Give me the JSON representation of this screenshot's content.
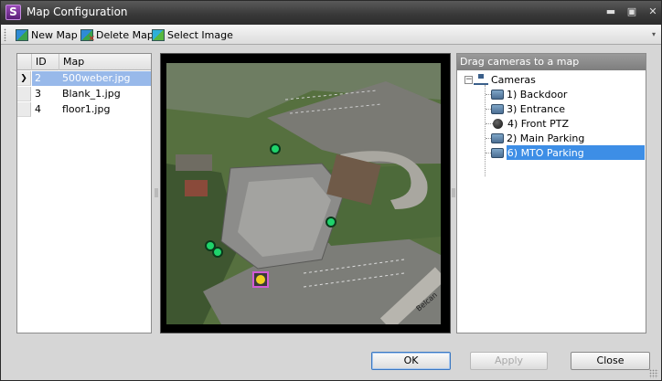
{
  "window": {
    "title": "Map Configuration",
    "app_icon_letter": "S"
  },
  "titlebar_buttons": {
    "minimize": "▬",
    "maximize": "▣",
    "close": "✕"
  },
  "toolbar": {
    "new_map": "New Map",
    "delete_map": "Delete Map",
    "select_image": "Select Image",
    "overflow": "▾"
  },
  "map_list": {
    "columns": {
      "id": "ID",
      "map": "Map"
    },
    "current_row_marker": "❯",
    "rows": [
      {
        "id": "2",
        "map": "500weber.jpg",
        "selected": true
      },
      {
        "id": "3",
        "map": "Blank_1.jpg",
        "selected": false
      },
      {
        "id": "4",
        "map": "floor1.jpg",
        "selected": false
      }
    ]
  },
  "map_view": {
    "road_label": "Belcan"
  },
  "camera_tree": {
    "header": "Drag cameras to a map",
    "root": {
      "label": "Cameras",
      "expander": "−"
    },
    "items": [
      {
        "label": "1) Backdoor",
        "icon": "camera-icon",
        "selected": false
      },
      {
        "label": "3) Entrance",
        "icon": "camera-icon",
        "selected": false
      },
      {
        "label": "4) Front PTZ",
        "icon": "ptz-camera-icon",
        "selected": false
      },
      {
        "label": "2) Main Parking",
        "icon": "camera-icon",
        "selected": false
      },
      {
        "label": "6) MTO Parking",
        "icon": "camera-icon",
        "selected": true
      }
    ]
  },
  "buttons": {
    "ok": "OK",
    "apply": "Apply",
    "close": "Close"
  },
  "colors": {
    "selection": "#98b9ea",
    "tree_selection": "#3d8ee6",
    "camera_marker": "#1fd36b",
    "selected_marker_border": "#d25bd6",
    "selected_marker_fill": "#f0d020"
  }
}
